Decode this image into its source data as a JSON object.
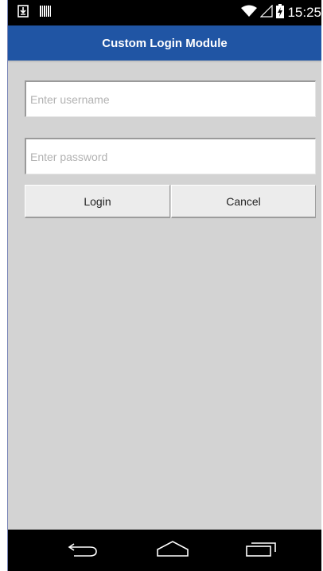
{
  "status_bar": {
    "time": "15:25",
    "icons": [
      "download-notification-icon",
      "barcode-notification-icon",
      "wifi-icon",
      "signal-icon",
      "battery-charging-icon"
    ]
  },
  "title_bar": {
    "title": "Custom Login Module",
    "background_color": "#2055a4"
  },
  "form": {
    "username": {
      "value": "",
      "placeholder": "Enter username"
    },
    "password": {
      "value": "",
      "placeholder": "Enter password"
    },
    "login_label": "Login",
    "cancel_label": "Cancel"
  },
  "nav_bar": {
    "icons": [
      "back-icon",
      "home-icon",
      "recent-apps-icon"
    ]
  }
}
